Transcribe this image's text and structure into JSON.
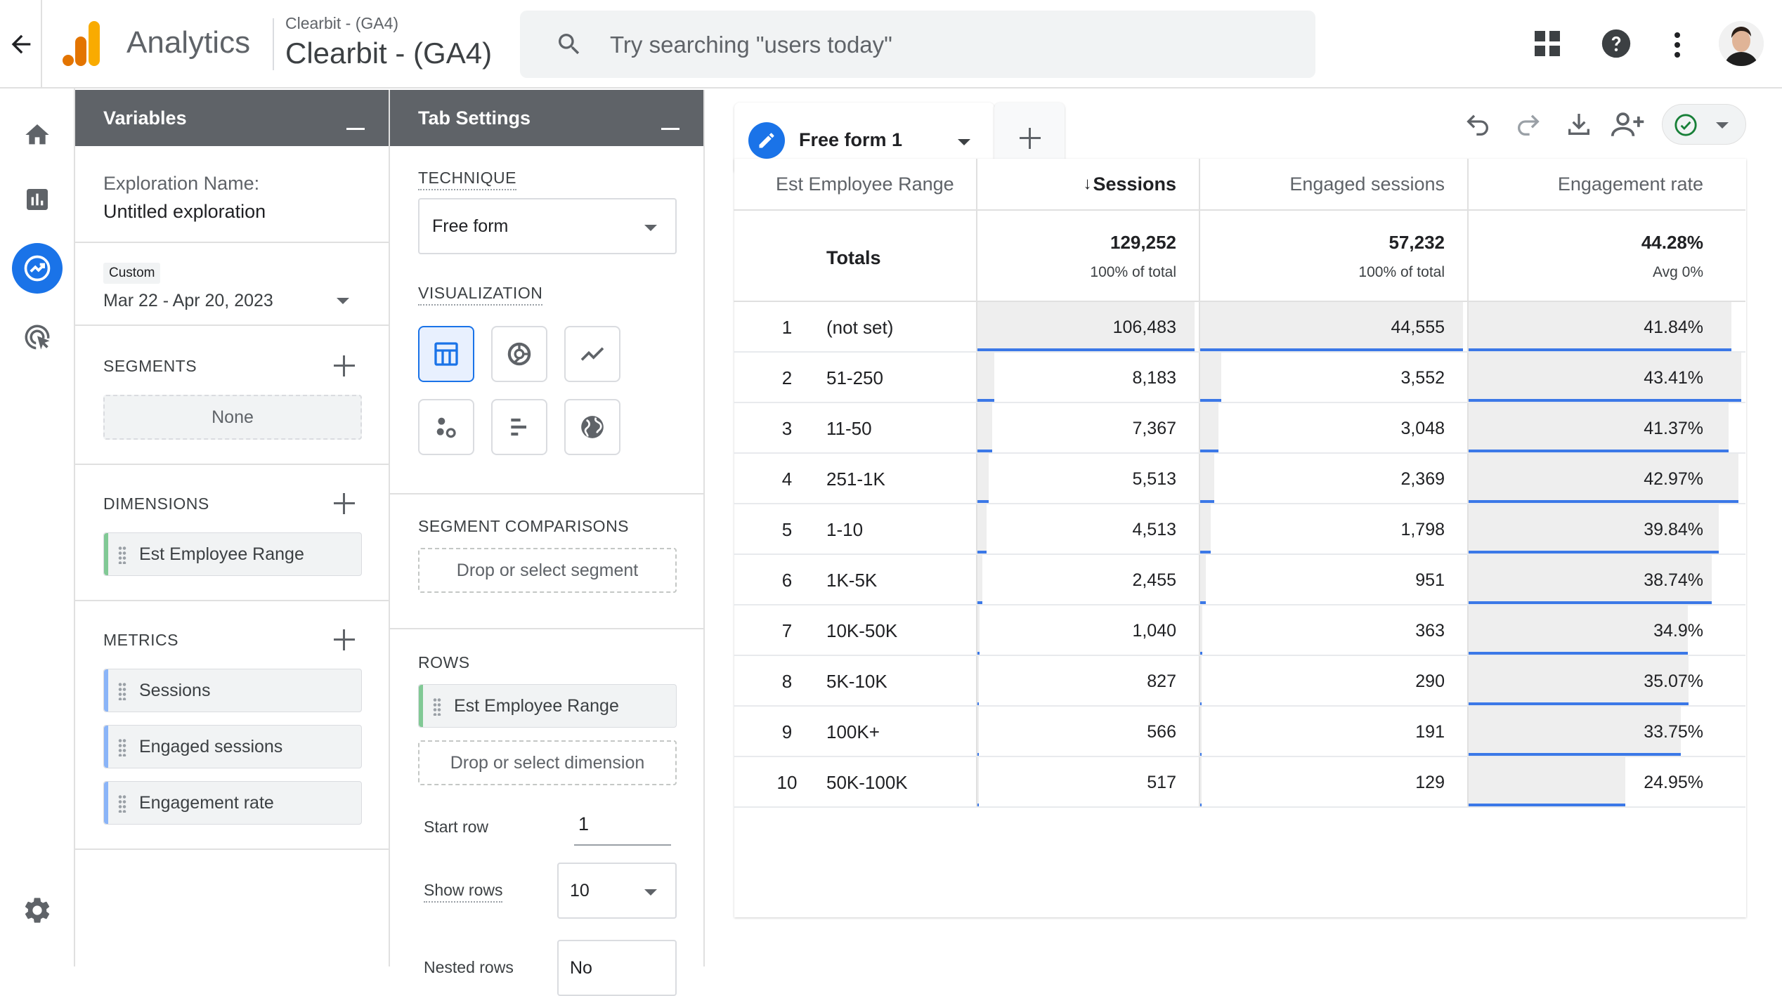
{
  "header": {
    "app_name": "Analytics",
    "property_small": "Clearbit - (GA4)",
    "property_large": "Clearbit - (GA4)",
    "search_placeholder": "Try searching \"users today\""
  },
  "variables_panel": {
    "title": "Variables",
    "exploration_name_label": "Exploration Name:",
    "exploration_name_value": "Untitled exploration",
    "date_badge": "Custom",
    "date_range": "Mar 22 - Apr 20, 2023",
    "segments_label": "SEGMENTS",
    "segments_none": "None",
    "dimensions_label": "DIMENSIONS",
    "dimensions": [
      "Est Employee Range"
    ],
    "metrics_label": "METRICS",
    "metrics": [
      "Sessions",
      "Engaged sessions",
      "Engagement rate"
    ]
  },
  "tab_settings": {
    "title": "Tab Settings",
    "technique_label": "TECHNIQUE",
    "technique_value": "Free form",
    "visualization_label": "VISUALIZATION",
    "segment_comparisons_label": "SEGMENT COMPARISONS",
    "segment_drop": "Drop or select segment",
    "rows_label": "ROWS",
    "rows_dimension": "Est Employee Range",
    "rows_drop": "Drop or select dimension",
    "start_row_label": "Start row",
    "start_row_value": "1",
    "show_rows_label": "Show rows",
    "show_rows_value": "10",
    "nested_rows_label": "Nested rows",
    "nested_rows_value": "No"
  },
  "canvas": {
    "tab_name": "Free form 1"
  },
  "table": {
    "columns": [
      "Est Employee Range",
      "Sessions",
      "Engaged sessions",
      "Engagement rate"
    ],
    "totals_label": "Totals",
    "totals": [
      {
        "value": "129,252",
        "sub": "100% of total"
      },
      {
        "value": "57,232",
        "sub": "100% of total"
      },
      {
        "value": "44.28%",
        "sub": "Avg 0%"
      }
    ],
    "rows": [
      {
        "idx": "1",
        "dim": "(not set)",
        "sessions": "106,483",
        "engaged": "44,555",
        "rate": "41.84%",
        "s": 106483,
        "e": 44555,
        "r": 41.84
      },
      {
        "idx": "2",
        "dim": "51-250",
        "sessions": "8,183",
        "engaged": "3,552",
        "rate": "43.41%",
        "s": 8183,
        "e": 3552,
        "r": 43.41
      },
      {
        "idx": "3",
        "dim": "11-50",
        "sessions": "7,367",
        "engaged": "3,048",
        "rate": "41.37%",
        "s": 7367,
        "e": 3048,
        "r": 41.37
      },
      {
        "idx": "4",
        "dim": "251-1K",
        "sessions": "5,513",
        "engaged": "2,369",
        "rate": "42.97%",
        "s": 5513,
        "e": 2369,
        "r": 42.97
      },
      {
        "idx": "5",
        "dim": "1-10",
        "sessions": "4,513",
        "engaged": "1,798",
        "rate": "39.84%",
        "s": 4513,
        "e": 1798,
        "r": 39.84
      },
      {
        "idx": "6",
        "dim": "1K-5K",
        "sessions": "2,455",
        "engaged": "951",
        "rate": "38.74%",
        "s": 2455,
        "e": 951,
        "r": 38.74
      },
      {
        "idx": "7",
        "dim": "10K-50K",
        "sessions": "1,040",
        "engaged": "363",
        "rate": "34.9%",
        "s": 1040,
        "e": 363,
        "r": 34.9
      },
      {
        "idx": "8",
        "dim": "5K-10K",
        "sessions": "827",
        "engaged": "290",
        "rate": "35.07%",
        "s": 827,
        "e": 290,
        "r": 35.07
      },
      {
        "idx": "9",
        "dim": "100K+",
        "sessions": "566",
        "engaged": "191",
        "rate": "33.75%",
        "s": 566,
        "e": 191,
        "r": 33.75
      },
      {
        "idx": "10",
        "dim": "50K-100K",
        "sessions": "517",
        "engaged": "129",
        "rate": "24.95%",
        "s": 517,
        "e": 129,
        "r": 24.95
      }
    ]
  },
  "colors": {
    "accent_blue": "#1a73e8",
    "bar_blue": "#3b78e7",
    "panel_header": "#5f6368",
    "logo_orange": "#f9ab00",
    "logo_dark_orange": "#e37400",
    "dimension_green": "#81c995",
    "metric_blue": "#8ab4f8"
  }
}
